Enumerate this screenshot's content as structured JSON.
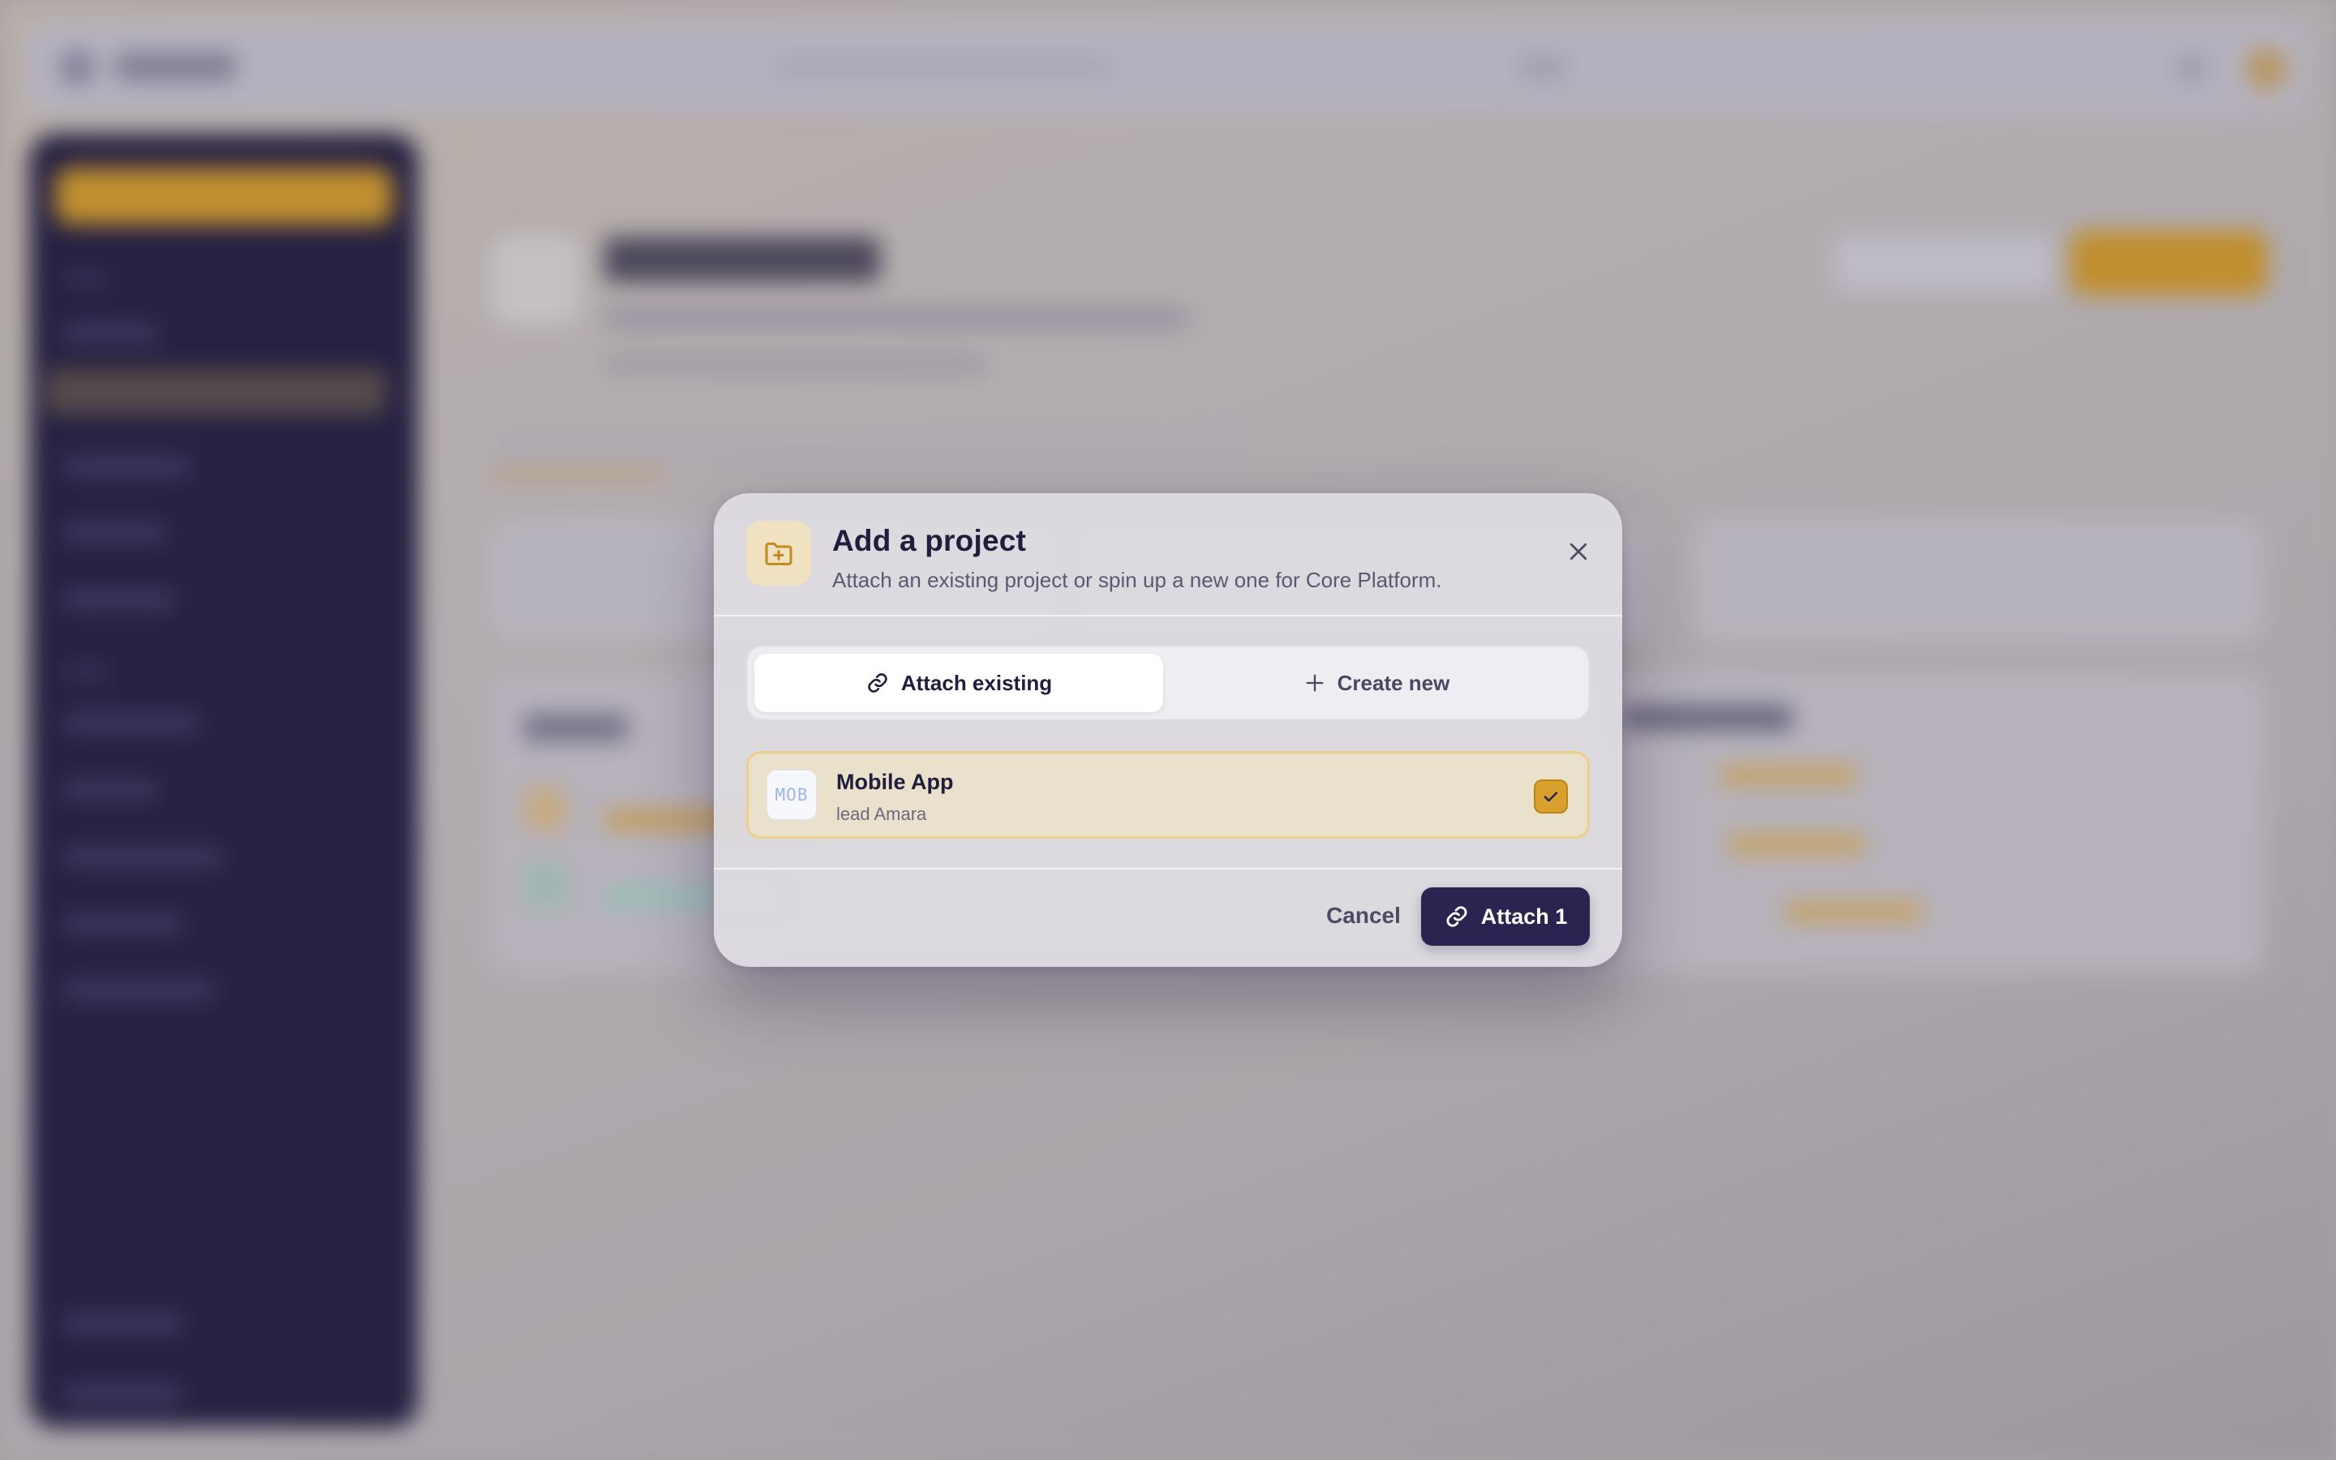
{
  "modal": {
    "title": "Add a project",
    "subtitle": "Attach an existing project or spin up a new one for Core Platform.",
    "icon": "folder-plus-icon",
    "close_icon": "close-icon",
    "tabs": [
      {
        "label": "Attach existing",
        "icon": "link-icon",
        "active": true
      },
      {
        "label": "Create new",
        "icon": "plus-icon",
        "active": false
      }
    ],
    "projects": [
      {
        "badge": "MOB",
        "name": "Mobile App",
        "lead": "lead Amara",
        "selected": true
      }
    ],
    "footer": {
      "cancel_label": "Cancel",
      "attach_label": "Attach 1",
      "attach_icon": "link-icon"
    }
  },
  "colors": {
    "accent_gold": "#d9a02e",
    "primary_navy": "#2a2550",
    "sidebar_bg": "#221d40",
    "selected_row_bg": "#e9e1cb"
  }
}
